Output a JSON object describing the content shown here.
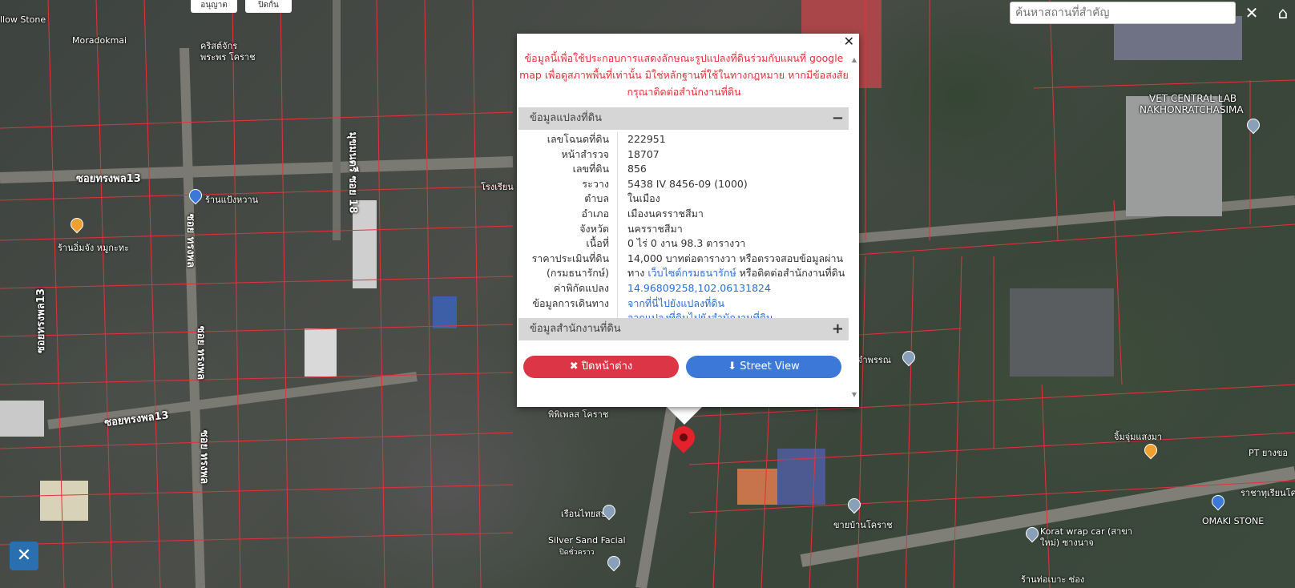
{
  "search": {
    "placeholder": "ค้นหาสถานที่สำคัญ"
  },
  "top_buttons": [
    "อนุญาต",
    "ปิดกั้น"
  ],
  "map_labels": {
    "willow": "llow Stone",
    "moradok": "Moradokmai",
    "church": "คริสต์จักร",
    "church2": "พระพร โคราช",
    "soi_songphon13_a": "ซอยทรงพล13",
    "soi_songphon13_b": "ซอยทรงพล13",
    "soi_songphon13_v": "ซอยทรงพล13",
    "soi_songphon_v": "ซอย ทรงพล",
    "soi_songphon_v2": "ซอย ทรงพล",
    "soi_songphon_v3": "ซอย ทรงพล",
    "shop_plawan": "ร้านแป้งหวาน",
    "shop_imjung": "ร้านอิ่มจัง หมูกะทะ",
    "soi18": "มุขมนตรี ซอย 18",
    "school": "โรงเรียน",
    "vet1": "VET CENTRAL LAB",
    "vet2": "NAKHONRATCHASIMA",
    "phipel": "พิพิเพลส โคราช",
    "jim": "จิ้มจุ่มแสงมา",
    "pt": "PT ยางขอ",
    "ratchabhat": "ราชาทุเรียนโค",
    "omaki": "OMAKI STONE",
    "korat_wrap": "Korat wrap car (สาขา",
    "korat_wrap2": "ใหม่) ซางนาจ",
    "khai_ban": "ขายบ้านโคราช",
    "ruenthai": "เรือนไทยสปา",
    "silver": "Silver Sand Facial",
    "silver2": "ปิดชั่วคราว",
    "tam_phan": "จำพรรณ",
    "shop_bottom": "ร้านท่อเบาะ ซ่อง"
  },
  "popup": {
    "disclaimer": "ข้อมูลนี้เพื่อใช้ประกอบการแสดงลักษณะรูปแปลงที่ดินร่วมกับแผนที่ google map เพื่อดูสภาพพื้นที่เท่านั้น มิใช่หลักฐานที่ใช้ในทางกฎหมาย หากมีข้อสงสัย กรุณาติดต่อสำนักงานที่ดิน",
    "section1": "ข้อมูลแปลงที่ดิน",
    "section1_toggle": "−",
    "section2": "ข้อมูลสำนักงานที่ดิน",
    "section2_toggle": "+",
    "rows": [
      {
        "k": "เลขโฉนดที่ดิน",
        "v": "222951"
      },
      {
        "k": "หน้าสำรวจ",
        "v": "18707"
      },
      {
        "k": "เลขที่ดิน",
        "v": "856"
      },
      {
        "k": "ระวาง",
        "v": "5438 IV 8456-09 (1000)"
      },
      {
        "k": "ตำบล",
        "v": "ในเมือง"
      },
      {
        "k": "อำเภอ",
        "v": "เมืองนครราชสีมา"
      },
      {
        "k": "จังหวัด",
        "v": "นครราชสีมา"
      },
      {
        "k": "เนื้อที่",
        "v": "0 ไร่ 0 งาน 98.3 ตารางวา"
      }
    ],
    "price_key": "ราคาประเมินที่ดิน",
    "price_key2": "(กรมธนารักษ์)",
    "price_v1": "14,000 บาทต่อตารางวา หรือตรวจสอบข้อมูลผ่าน",
    "price_v2a": "ทาง ",
    "price_link": "เว็บไซต์กรมธนารักษ์",
    "price_v2b": " หรือติดต่อสำนักงานที่ดิน",
    "coord_key": "ค่าพิกัดแปลง",
    "coord_v": "14.96809258,102.06131824",
    "travel_key": "ข้อมูลการเดินทาง",
    "travel_1": "จากที่นี่ไปยังแปลงที่ดิน",
    "travel_2": "จากแปลงที่ดินไปยังสำนักงานที่ดิน",
    "close_btn": "✖ ปิดหน้าต่าง",
    "street_btn": "⬇ Street View"
  },
  "colors": {
    "red": "#dc3545",
    "blue": "#3b78d8",
    "parcel_line": "#e8303a"
  }
}
